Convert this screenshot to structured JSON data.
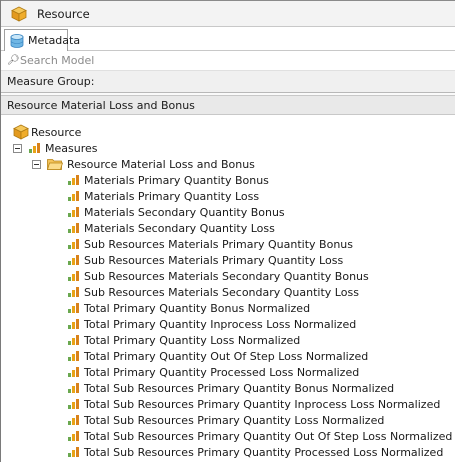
{
  "window": {
    "title": "Resource"
  },
  "tabs": [
    {
      "label": "Metadata"
    }
  ],
  "search": {
    "placeholder": "Search Model"
  },
  "measure_group": {
    "label": "Measure Group:",
    "value": "Resource Material Loss and Bonus"
  },
  "tree": {
    "root": "Resource",
    "measures_label": "Measures",
    "folder_label": "Resource Material Loss and Bonus",
    "items": [
      "Materials Primary Quantity Bonus",
      "Materials Primary Quantity Loss",
      "Materials Secondary Quantity Bonus",
      "Materials Secondary Quantity Loss",
      "Sub Resources Materials Primary Quantity Bonus",
      "Sub Resources Materials Primary Quantity Loss",
      "Sub Resources Materials Secondary Quantity Bonus",
      "Sub Resources Materials Secondary Quantity Loss",
      "Total Primary Quantity Bonus Normalized",
      "Total Primary Quantity Inprocess Loss Normalized",
      "Total Primary Quantity Loss Normalized",
      "Total Primary Quantity Out Of Step Loss Normalized",
      "Total Primary Quantity Processed Loss Normalized",
      "Total Sub Resources Primary Quantity Bonus Normalized",
      "Total Sub Resources Primary Quantity Inprocess Loss Normalized",
      "Total Sub Resources Primary Quantity Loss Normalized",
      "Total Sub Resources Primary Quantity Out Of Step Loss Normalized",
      "Total Sub Resources Primary Quantity Processed Loss Normalized"
    ]
  }
}
